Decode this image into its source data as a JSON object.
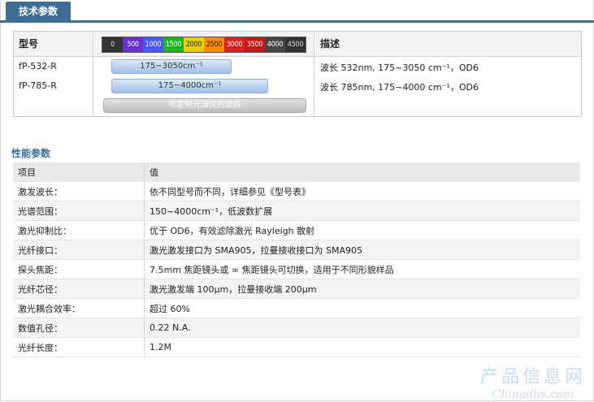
{
  "tab": {
    "label": "技术参数"
  },
  "spec": {
    "header": {
      "model": "型号",
      "desc": "描述"
    },
    "scale": [
      "0",
      "500",
      "1000",
      "1500",
      "2000",
      "2500",
      "3000",
      "3500",
      "4000",
      "4500"
    ],
    "scale_colors": [
      "#333333",
      "#6b2fd0",
      "#4a56ff",
      "#1db51d",
      "#e6d000",
      "#ff8a00",
      "#e02020",
      "#c21818",
      "#444444",
      "#333333"
    ],
    "rows": [
      {
        "model": "fP-532-R",
        "range": "175~3050cm⁻¹",
        "desc": "波长 532nm, 175~3050 cm⁻¹，OD6"
      },
      {
        "model": "fP-785-R",
        "range": "175~4000cm⁻¹",
        "desc": "波长 785nm, 175~4000 cm⁻¹，OD6"
      }
    ],
    "custom_label": "可定制光谱仪的波段"
  },
  "perf": {
    "title": "性能参数",
    "header": [
      "项目",
      "值"
    ],
    "rows": [
      [
        "激发波长：",
        "依不同型号而不同，详细参见《型号表》"
      ],
      [
        "光谱范围：",
        "150~4000cm⁻¹，低波数扩展"
      ],
      [
        "激光抑制比：",
        "优于 OD6，有效滤除激光 Rayleigh 散射"
      ],
      [
        "光纤接口：",
        "激光激发接口为 SMA905，拉曼接收接口为 SMA905"
      ],
      [
        "探头焦距：",
        "7.5mm 焦距镜头或 ∞ 焦距镜头可切换，适用于不同形貌样品"
      ],
      [
        "光纤芯径：",
        "激光激发端 100μm，拉曼接收端 200μm"
      ],
      [
        "激光耦合效率：",
        "超过 60%"
      ],
      [
        "数值孔径：",
        "0.22 N.A."
      ],
      [
        "光纤长度：",
        "1.2M"
      ]
    ]
  },
  "watermark": {
    "line1": "产品信息网",
    "line2": "Chinadbs.com"
  }
}
